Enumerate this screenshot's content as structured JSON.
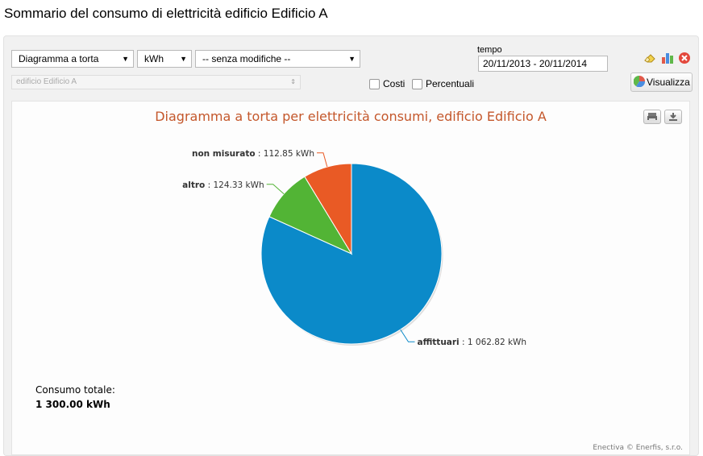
{
  "page": {
    "title": "Sommario del consumo di elettricità edificio Edificio A"
  },
  "controls": {
    "chart_type": "Diagramma a torta",
    "unit": "kWh",
    "modifier": "-- senza modifiche --",
    "building": "edificio Edificio A",
    "tempo_label": "tempo",
    "date_range": "20/11/2013 - 20/11/2014",
    "costs_label": "Costi",
    "costs_checked": false,
    "percent_label": "Percentuali",
    "percent_checked": false,
    "visualize_label": "Visualizza"
  },
  "icons": {
    "eraser": "eraser-icon",
    "chart": "bar-chart-icon",
    "close": "close-icon",
    "print": "print-icon",
    "download": "download-icon",
    "visualize": "pie-globe-icon"
  },
  "colors": {
    "affittuari": "#0b8ac9",
    "altro": "#52b435",
    "non_misurato": "#e95a25",
    "title": "#c4572b"
  },
  "summary": {
    "total_label": "Consumo totale:",
    "total_value": "1 300.00 kWh",
    "credits": "Enectiva © Enerfis, s.r.o."
  },
  "chart_data": {
    "type": "pie",
    "title": "Diagramma a torta per elettricità consumi, edificio Edificio A",
    "unit": "kWh",
    "slices": [
      {
        "name": "affittuari",
        "value": 1062.82,
        "label": "1 062.82 kWh"
      },
      {
        "name": "altro",
        "value": 124.33,
        "label": "124.33 kWh"
      },
      {
        "name": "non misurato",
        "value": 112.85,
        "label": "112.85 kWh"
      }
    ]
  }
}
